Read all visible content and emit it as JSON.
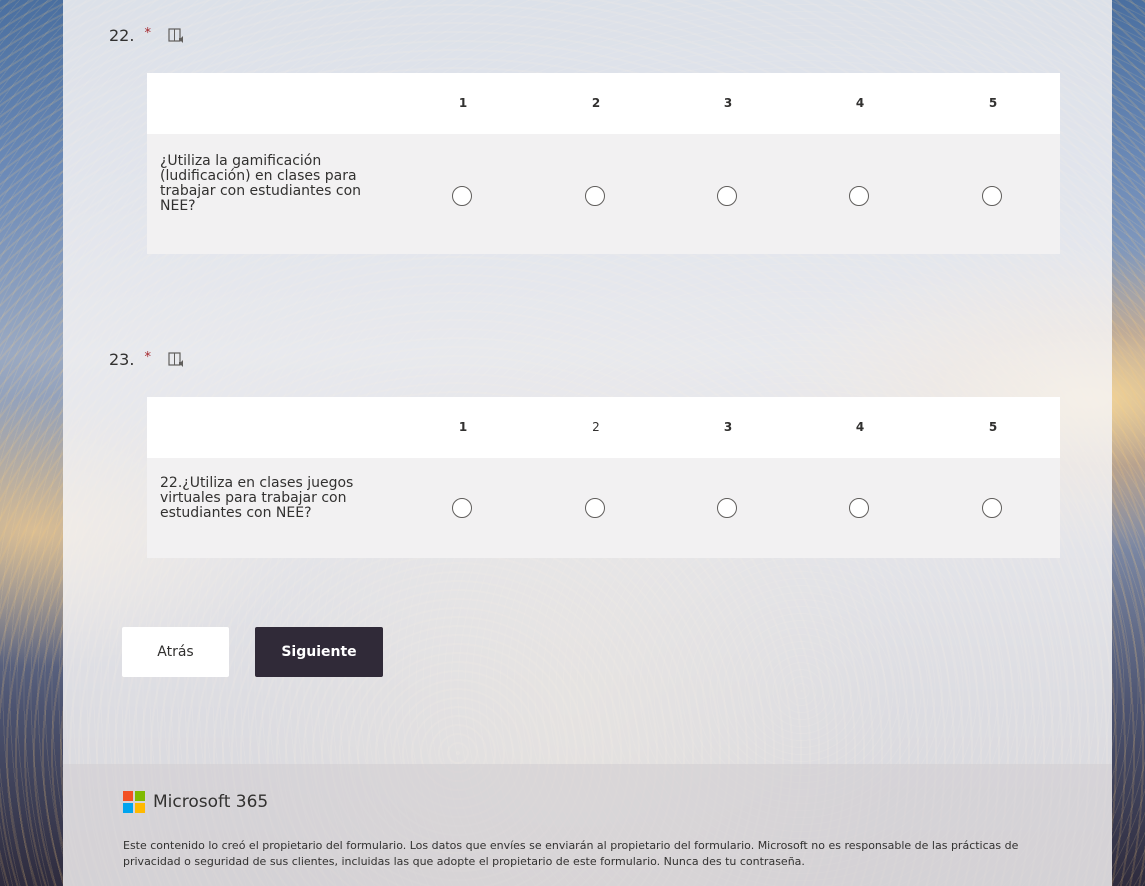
{
  "questions": [
    {
      "number": "22.",
      "required_mark": "*",
      "scale": [
        "1",
        "2",
        "3",
        "4",
        "5"
      ],
      "statement": "¿Utiliza la gamificación (ludificación) en clases para trabajar con estudiantes con NEE?"
    },
    {
      "number": "23.",
      "required_mark": "*",
      "scale": [
        "1",
        "2",
        "3",
        "4",
        "5"
      ],
      "statement": "22.¿Utiliza en clases juegos virtuales para trabajar con estudiantes con NEE?"
    }
  ],
  "navigation": {
    "back_label": "Atrás",
    "next_label": "Siguiente"
  },
  "footer": {
    "brand": "Microsoft 365",
    "disclaimer": "Este contenido lo creó el propietario del formulario. Los datos que envíes se enviarán al propietario del formulario. Microsoft no es responsable de las prácticas de privacidad o seguridad de sus clientes, incluidas las que adopte el propietario de este formulario. Nunca des tu contraseña."
  },
  "colors": {
    "accent": "#302a38",
    "required": "#a4262c",
    "ms_red": "#f25022",
    "ms_green": "#7fba00",
    "ms_blue": "#00a4ef",
    "ms_yellow": "#ffb900"
  },
  "icons": {
    "reader": "immersive-reader-icon",
    "logo": "microsoft-logo-icon"
  }
}
